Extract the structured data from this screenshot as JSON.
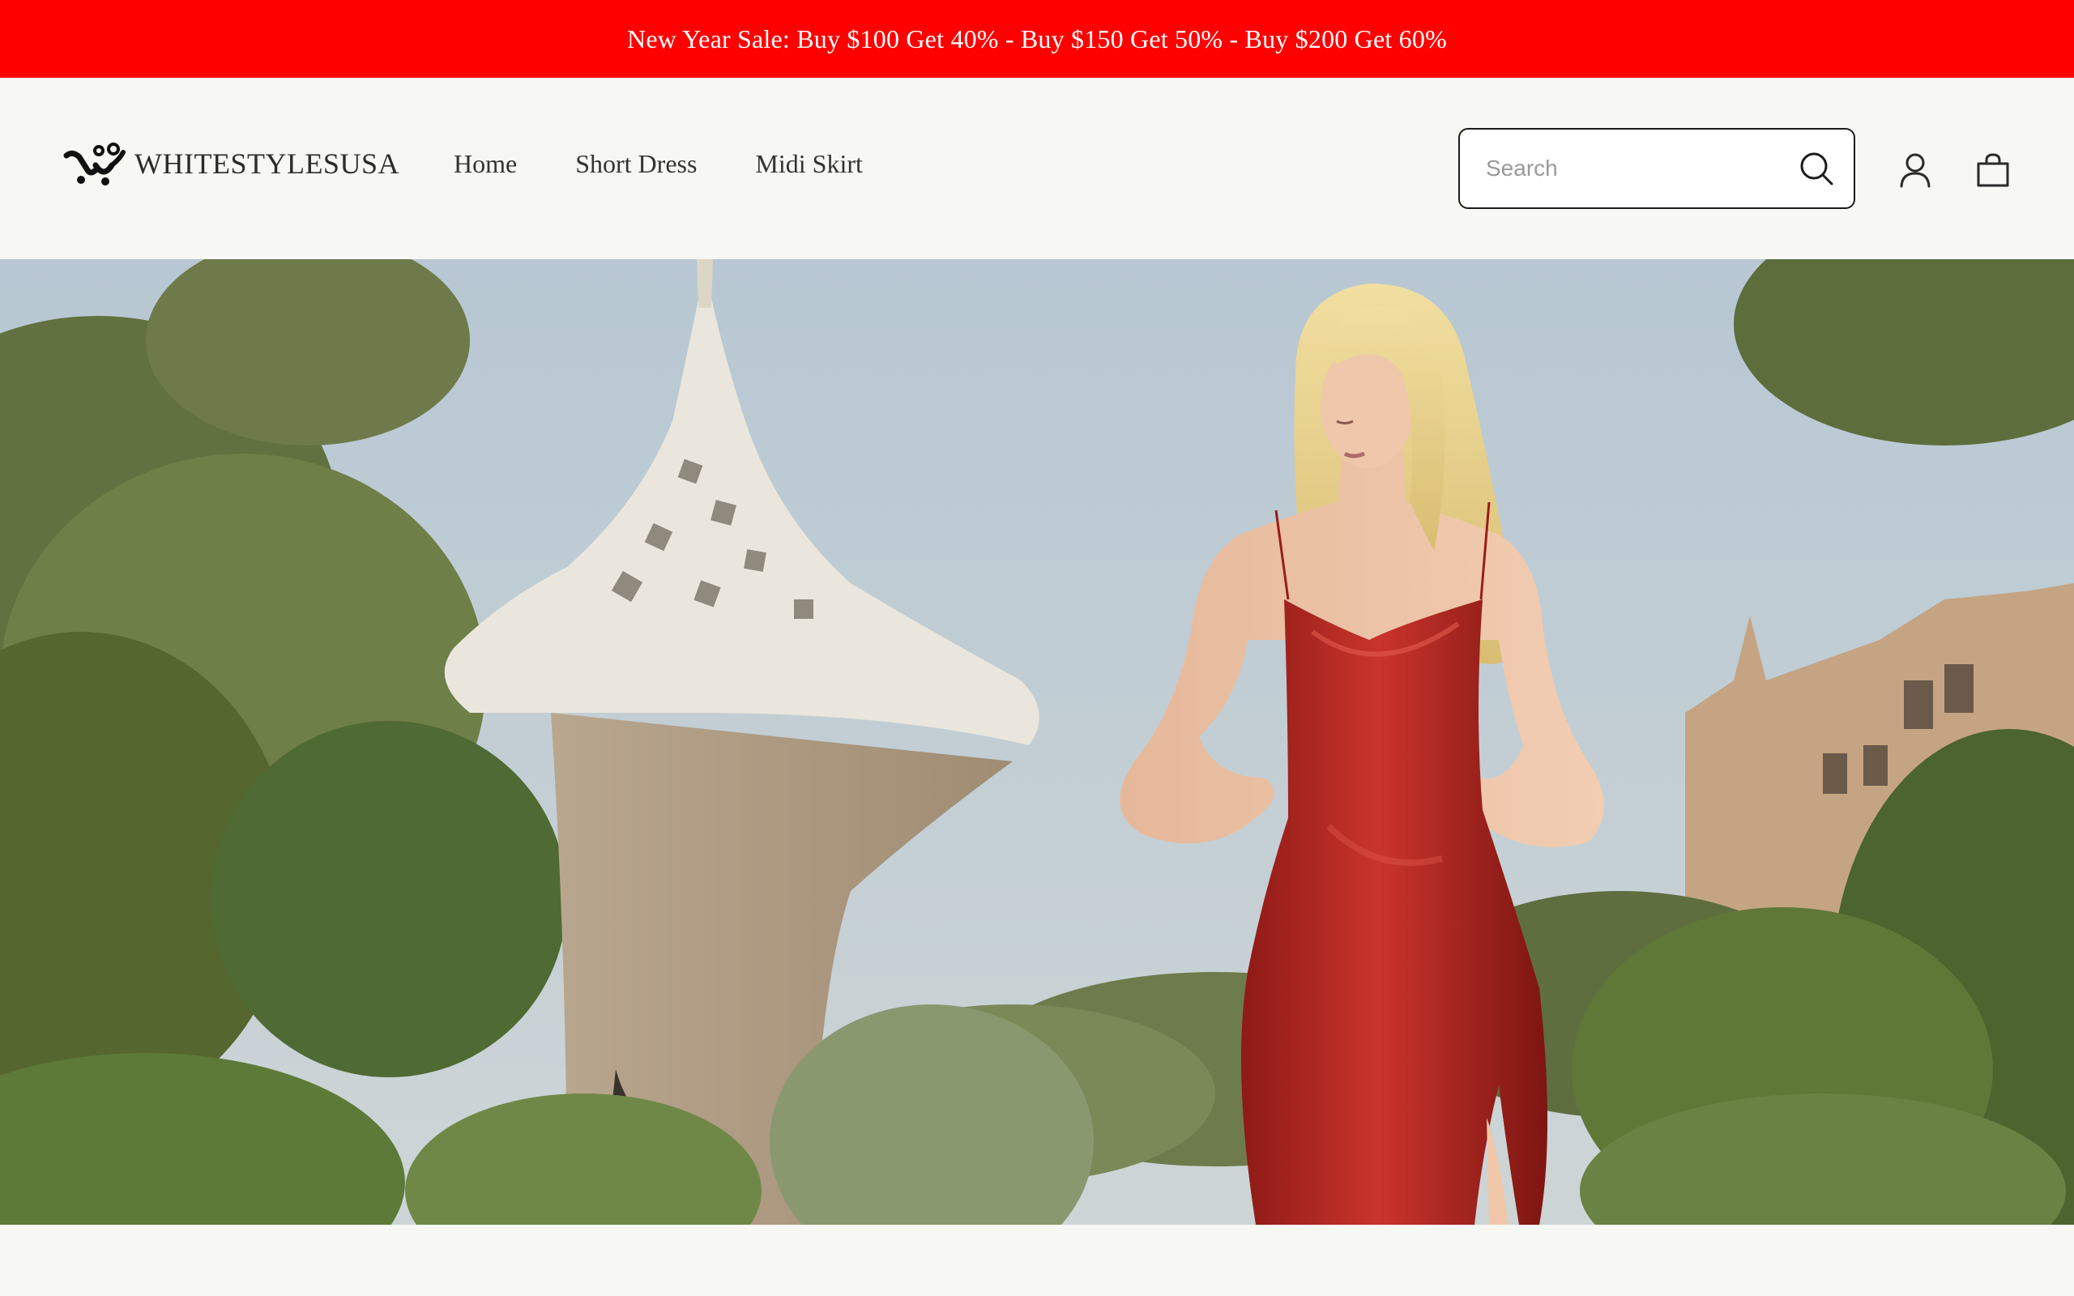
{
  "announcement": {
    "text": "New Year Sale: Buy $100 Get 40% - Buy $150 Get 50% - Buy $200 Get 60%",
    "background_color": "#ff0000",
    "text_color": "#ffffff"
  },
  "header": {
    "logo": {
      "icon": "brand-logo-icon",
      "text": "WHITESTYLESUSA"
    },
    "nav": [
      {
        "label": "Home"
      },
      {
        "label": "Short Dress"
      },
      {
        "label": "Midi Skirt"
      }
    ],
    "search": {
      "placeholder": "Search",
      "value": "",
      "icon": "search-icon"
    },
    "account_icon": "user-icon",
    "cart_icon": "shopping-bag-icon"
  },
  "hero": {
    "image": "model-in-red-satin-dress-garden-photo",
    "dress_color": "#b3231f"
  }
}
